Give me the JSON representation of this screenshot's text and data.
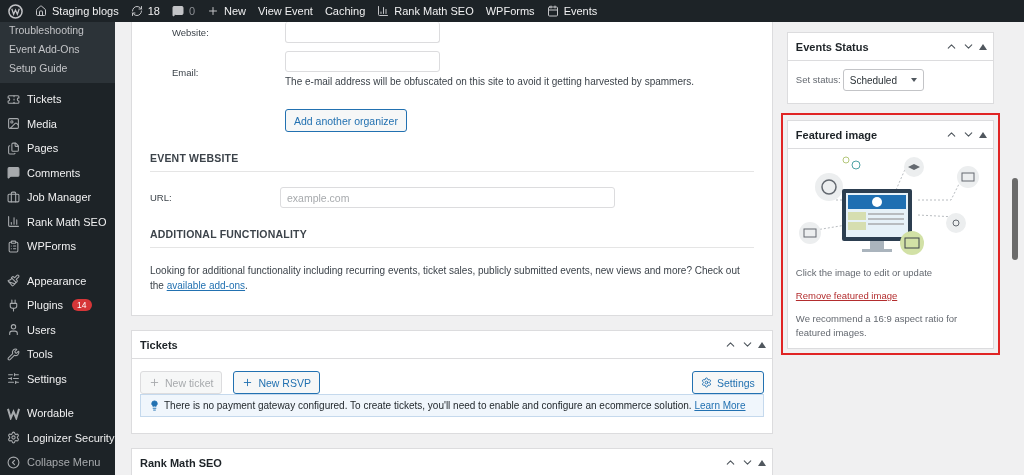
{
  "admin_bar": [
    {
      "kind": "logo"
    },
    {
      "kind": "site",
      "label": "Staging blogs"
    },
    {
      "kind": "updates",
      "label": "18"
    },
    {
      "kind": "comments",
      "label": "0"
    },
    {
      "kind": "new",
      "label": "New"
    },
    {
      "kind": "text",
      "label": "View Event"
    },
    {
      "kind": "text",
      "label": "Caching"
    },
    {
      "kind": "seo",
      "label": "Rank Math SEO"
    },
    {
      "kind": "text",
      "label": "WPForms"
    },
    {
      "kind": "events",
      "label": "Events"
    }
  ],
  "sidebar": {
    "submenu": [
      "Troubleshooting",
      "Event Add-Ons",
      "Setup Guide"
    ],
    "groups": [
      [
        {
          "kind": "ticket",
          "label": "Tickets"
        },
        {
          "kind": "media",
          "label": "Media"
        },
        {
          "kind": "pages",
          "label": "Pages"
        },
        {
          "kind": "comments",
          "label": "Comments"
        },
        {
          "kind": "job",
          "label": "Job Manager"
        },
        {
          "kind": "seo",
          "label": "Rank Math SEO"
        },
        {
          "kind": "forms",
          "label": "WPForms"
        }
      ],
      [
        {
          "kind": "brush",
          "label": "Appearance"
        },
        {
          "kind": "plug",
          "label": "Plugins",
          "badge": "14"
        },
        {
          "kind": "user",
          "label": "Users"
        },
        {
          "kind": "wrench",
          "label": "Tools"
        },
        {
          "kind": "sliders",
          "label": "Settings"
        }
      ],
      [
        {
          "kind": "w",
          "label": "Wordable"
        },
        {
          "kind": "gear",
          "label": "Loginizer Security"
        },
        {
          "kind": "collapse",
          "label": "Collapse Menu"
        }
      ]
    ]
  },
  "organizer": {
    "website_label": "Website:",
    "email_label": "Email:",
    "email_help": "The e-mail address will be obfuscated on this site to avoid it getting harvested by spammers.",
    "add_button": "Add another organizer"
  },
  "event_website": {
    "heading": "EVENT WEBSITE",
    "url_label": "URL:",
    "url_placeholder": "example.com"
  },
  "additional": {
    "heading": "ADDITIONAL FUNCTIONALITY",
    "text": "Looking for additional functionality including recurring events, ticket sales, publicly submitted events, new views and more? Check out the",
    "link": "available add-ons",
    "after": "."
  },
  "tickets": {
    "title": "Tickets",
    "buttons": [
      {
        "kind": "add",
        "label": "New ticket",
        "disabled": true
      },
      {
        "kind": "add",
        "label": "New RSVP",
        "disabled": false
      },
      {
        "kind": "settings",
        "label": "Settings",
        "disabled": false
      }
    ],
    "notice": {
      "text": "There is no payment gateway configured. To create tickets, you'll need to enable and configure an ecommerce solution.",
      "link": "Learn More"
    }
  },
  "rank_math": {
    "title": "Rank Math SEO"
  },
  "events_status": {
    "title": "Events Status",
    "label": "Set status:",
    "value": "Scheduled"
  },
  "featured_image": {
    "title": "Featured image",
    "highlighted": true,
    "caption": "Click the image to edit or update",
    "remove_link": "Remove featured image",
    "note": "We recommend a 16:9 aspect ratio for featured images."
  }
}
